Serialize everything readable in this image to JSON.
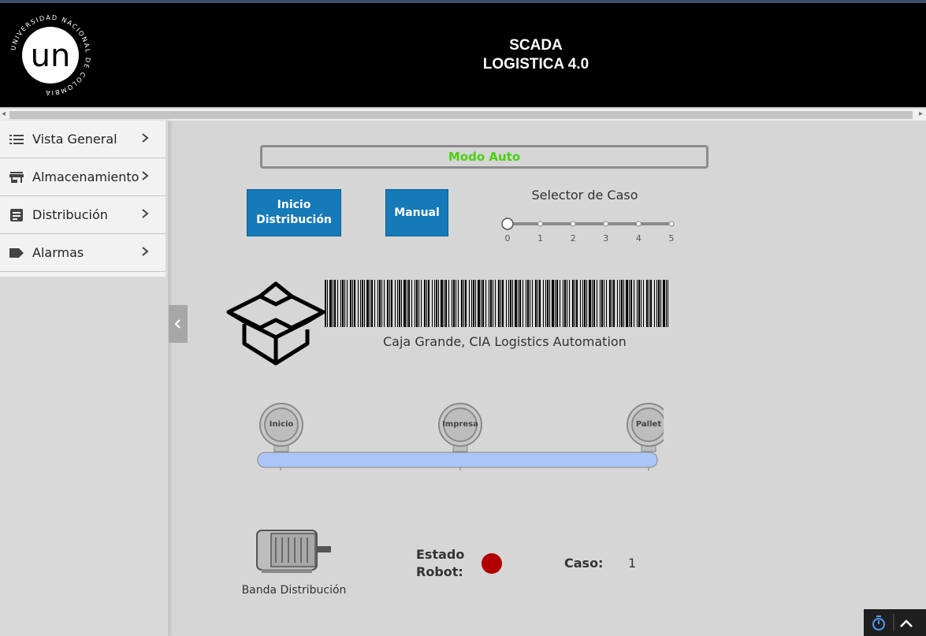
{
  "header": {
    "title_line1": "SCADA",
    "title_line2": "LOGISTICA 4.0",
    "logo_text": "un",
    "logo_ring_text": "UNIVERSIDAD NACIONAL DE COLOMBIA"
  },
  "sidebar": {
    "items": [
      {
        "label": "Vista General",
        "icon": "list-icon"
      },
      {
        "label": "Almacenamiento",
        "icon": "store-icon"
      },
      {
        "label": "Distribución",
        "icon": "document-icon"
      },
      {
        "label": "Alarmas",
        "icon": "tag-icon"
      }
    ]
  },
  "main": {
    "mode_label": "Modo Auto",
    "mode_color": "#4bd10f",
    "buttons": {
      "inicio_line1": "Inicio",
      "inicio_line2": "Distribución",
      "manual": "Manual"
    },
    "selector": {
      "title": "Selector de Caso",
      "ticks": [
        "0",
        "1",
        "2",
        "3",
        "4",
        "5"
      ],
      "value": 0
    },
    "barcode_caption": "Caja Grande, CIA Logistics Automation",
    "sensors": [
      "Inicio",
      "Impresa",
      "Pallet"
    ],
    "motor_label": "Banda Distribución",
    "estado_label_line1": "Estado",
    "estado_label_line2": "Robot:",
    "estado_color": "#b10000",
    "caso_label": "Caso:",
    "caso_value": "1"
  },
  "colors": {
    "accent": "#1679b8",
    "header_bg": "#000000",
    "belt": "#a9c6f6"
  }
}
